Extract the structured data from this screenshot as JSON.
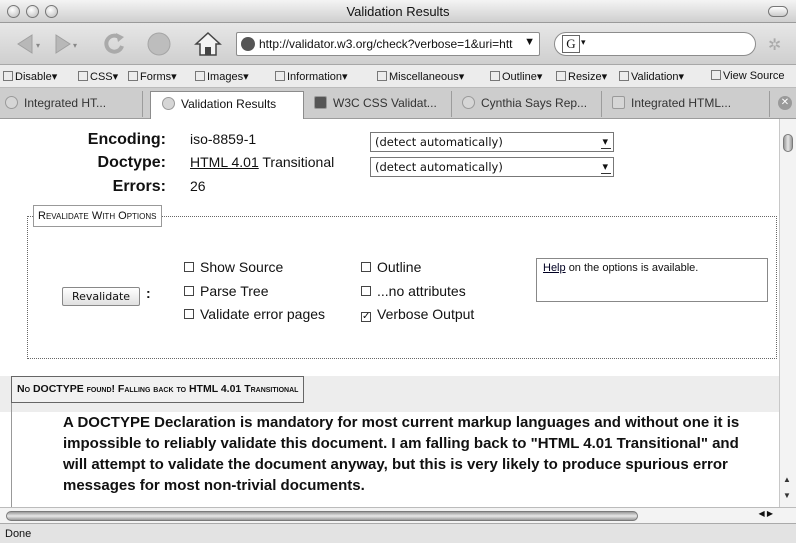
{
  "window": {
    "title": "Validation Results"
  },
  "nav": {
    "url": "http://validator.w3.org/check?verbose=1&uri=htt",
    "search_engine_letter": "G"
  },
  "devbar": {
    "items": [
      "Disable",
      "CSS",
      "Forms",
      "Images",
      "Information",
      "Miscellaneous",
      "Outline",
      "Resize",
      "Validation",
      "View Source"
    ]
  },
  "tabs": [
    {
      "label": "Integrated HT...",
      "active": false
    },
    {
      "label": "Validation Results",
      "active": true
    },
    {
      "label": "W3C CSS Validat...",
      "active": false
    },
    {
      "label": "Cynthia Says Rep...",
      "active": false
    },
    {
      "label": "Integrated HTML...",
      "active": false
    }
  ],
  "results": {
    "encoding_label": "Encoding:",
    "encoding_value": "iso-8859-1",
    "doctype_label": "Doctype:",
    "doctype_link": "HTML 4.01",
    "doctype_suffix": "Transitional",
    "errors_label": "Errors:",
    "errors_value": "26",
    "encoding_select": "(detect automatically)",
    "doctype_select": "(detect automatically)"
  },
  "revalidate": {
    "legend": "Revalidate With Options",
    "button": "Revalidate",
    "colon": ":",
    "options": {
      "show_source": {
        "label": "Show Source",
        "checked": false
      },
      "parse_tree": {
        "label": "Parse Tree",
        "checked": false
      },
      "validate_error_pages": {
        "label": "Validate error pages",
        "checked": false
      },
      "outline": {
        "label": "Outline",
        "checked": false
      },
      "no_attributes": {
        "label": "...no attributes",
        "checked": false
      },
      "verbose_output": {
        "label": "Verbose Output",
        "checked": true
      }
    },
    "help_link": "Help",
    "help_text": "on the options is available."
  },
  "message": {
    "heading": "No DOCTYPE found! Falling back to HTML 4.01 Transitional",
    "body": "A DOCTYPE Declaration is mandatory for most current markup languages and without one it is impossible to reliably validate this document. I am falling back to \"HTML 4.01 Transitional\" and will attempt to validate the document anyway, but this is very likely to produce spurious error messages for most non-trivial documents."
  },
  "status": {
    "text": "Done"
  }
}
